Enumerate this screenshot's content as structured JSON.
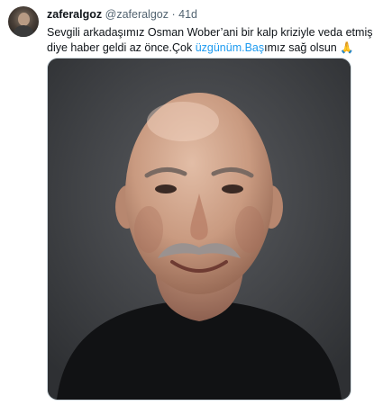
{
  "tweet": {
    "name": "zaferalgoz",
    "handle": "@zaferalgoz",
    "separator": "·",
    "time": "41d",
    "text_part1": "Sevgili arkadaşımız Osman Wober’ani bir kalp kriziyle veda etmiş diye haber geldi az önce.Çok ",
    "hashtag1": "üzgünüm.",
    "hashtag2": "Baş",
    "text_part2": "ımız sağ olsun ",
    "emoji": "🙏"
  },
  "colors": {
    "link": "#1d9bf0",
    "secondary_text": "#536471",
    "photo_background": "#3d3f43"
  },
  "icons": [
    "avatar-image",
    "praying-hands-emoji"
  ],
  "media": {
    "description": "Portrait photo of a bald man with grey mustache in black shirt"
  }
}
